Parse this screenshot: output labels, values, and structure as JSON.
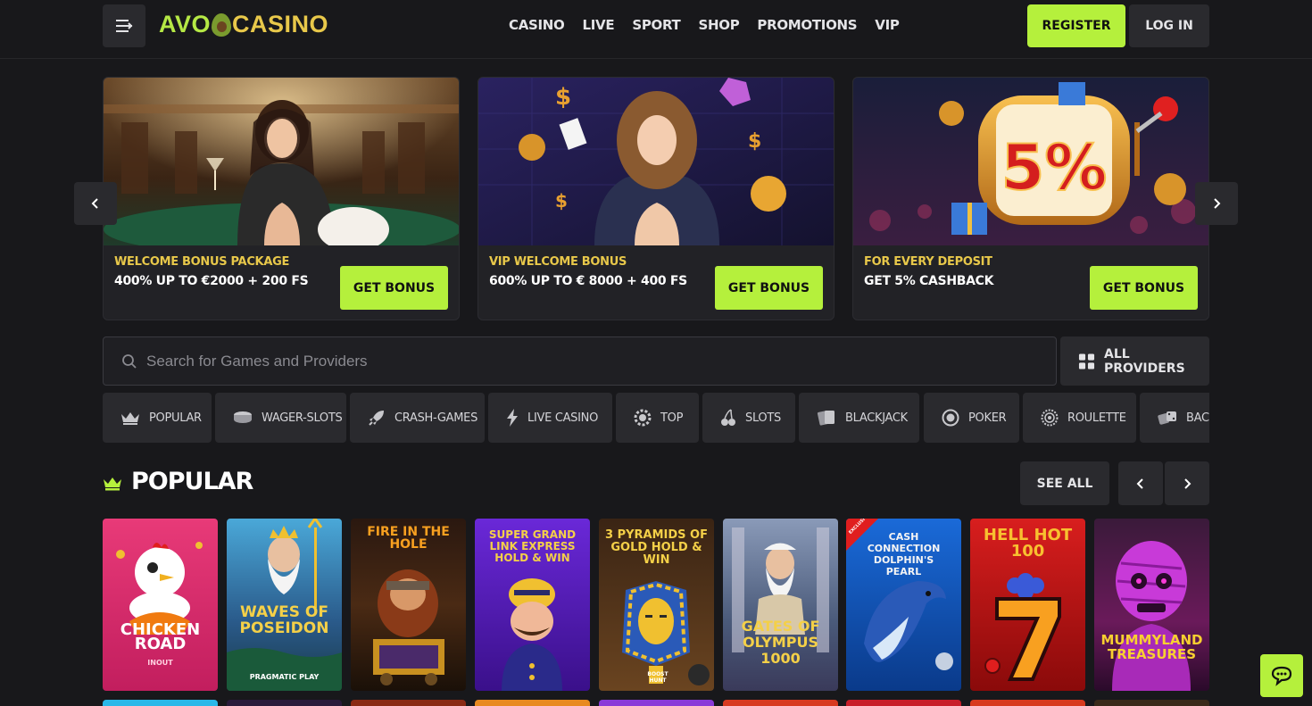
{
  "header": {
    "logo_left": "AVO",
    "logo_right": "CASINO",
    "nav": [
      "CASINO",
      "LIVE",
      "SPORT",
      "SHOP",
      "PROMOTIONS",
      "VIP"
    ],
    "register_label": "REGISTER",
    "login_label": "LOG IN"
  },
  "banners": [
    {
      "label": "WELCOME BONUS PACKAGE",
      "offer": "400% UP TO €2000 + 200 FS",
      "button": "GET BONUS"
    },
    {
      "label": "VIP WELCOME BONUS",
      "offer": "600% UP TO € 8000 + 400 FS",
      "button": "GET BONUS"
    },
    {
      "label": "FOR EVERY DEPOSIT",
      "offer": "GET 5% CASHBACK",
      "button": "GET BONUS",
      "image_text": "5%"
    }
  ],
  "search": {
    "placeholder": "Search for Games and Providers"
  },
  "providers_label": "ALL PROVIDERS",
  "categories": [
    "POPULAR",
    "WAGER-SLOTS",
    "CRASH-GAMES",
    "LIVE CASINO",
    "TOP",
    "SLOTS",
    "BLACKJACK",
    "POKER",
    "ROULETTE",
    "BACCARAT"
  ],
  "section": {
    "title": "POPULAR",
    "see_all": "SEE ALL"
  },
  "games": [
    {
      "title": "CHICKEN ROAD",
      "provider": "INOUT"
    },
    {
      "title": "WAVES OF POSEIDON",
      "provider": "PRAGMATIC PLAY"
    },
    {
      "title": "FIRE IN THE HOLE",
      "provider": ""
    },
    {
      "title": "SUPER GRAND LINK EXPRESS HOLD & WIN",
      "provider": ""
    },
    {
      "title": "3 PYRAMIDS OF GOLD HOLD & WIN",
      "provider": "BOOST HUNT"
    },
    {
      "title": "GATES OF OLYMPUS 1000",
      "provider": ""
    },
    {
      "title": "CASH CONNECTION DOLPHIN'S PEARL",
      "provider": "",
      "badge": "EXCLUSIVE"
    },
    {
      "title": "HELL HOT 100",
      "provider": ""
    },
    {
      "title": "MUMMYLAND TREASURES",
      "provider": ""
    }
  ],
  "colors": {
    "accent": "#b5f03c",
    "gold": "#e8c84a",
    "background": "#18181b",
    "panel": "#2a2a2e"
  }
}
